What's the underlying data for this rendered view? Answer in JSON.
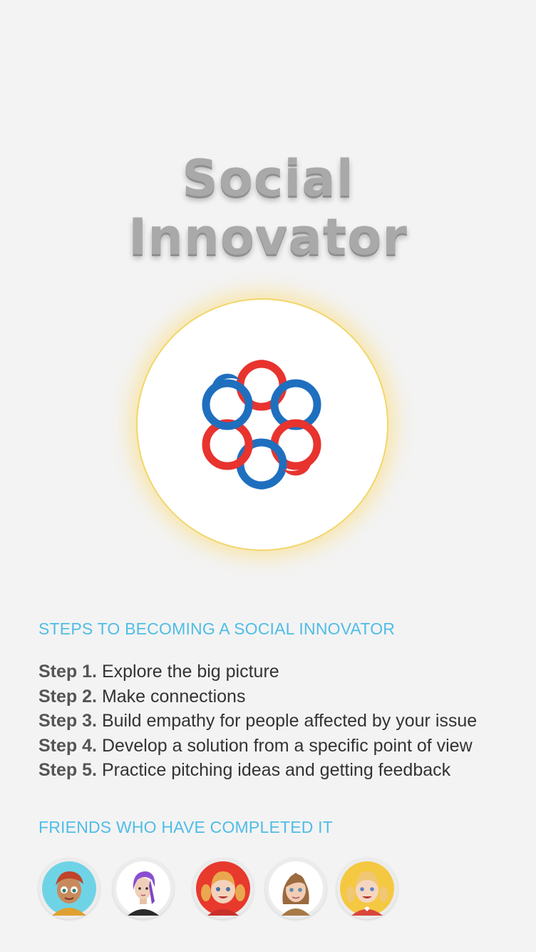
{
  "page": {
    "title_line1": "Social",
    "title_line2": "Innovator"
  },
  "badge": {
    "icon": "interlocking-rings-logo-icon",
    "colors": {
      "red": "#e8332e",
      "blue": "#1f6fbf",
      "glow": "#f2d66b"
    }
  },
  "steps_section": {
    "heading": "STEPS TO BECOMING A SOCIAL INNOVATOR",
    "steps": [
      {
        "num": "Step 1.",
        "text": " Explore the big picture"
      },
      {
        "num": "Step 2.",
        "text": "Make connections"
      },
      {
        "num": "Step 3.",
        "text": "Build empathy for people affected by your issue"
      },
      {
        "num": "Step 4.",
        "text": "Develop a solution from a specific point of view"
      },
      {
        "num": "Step 5.",
        "text": "Practice pitching ideas and getting feedback"
      }
    ]
  },
  "friends_section": {
    "heading": "FRIENDS WHO HAVE COMPLETED IT",
    "friends": [
      {
        "avatar": "boy-red-hair-avatar",
        "bg": "#6fd3e6"
      },
      {
        "avatar": "girl-purple-hair-avatar",
        "bg": "#ffffff"
      },
      {
        "avatar": "girl-pigtails-red-bg-avatar",
        "bg": "#e8392d"
      },
      {
        "avatar": "girl-brown-hair-avatar",
        "bg": "#ffffff"
      },
      {
        "avatar": "girl-blonde-yellow-bg-avatar",
        "bg": "#f5c842"
      }
    ]
  }
}
